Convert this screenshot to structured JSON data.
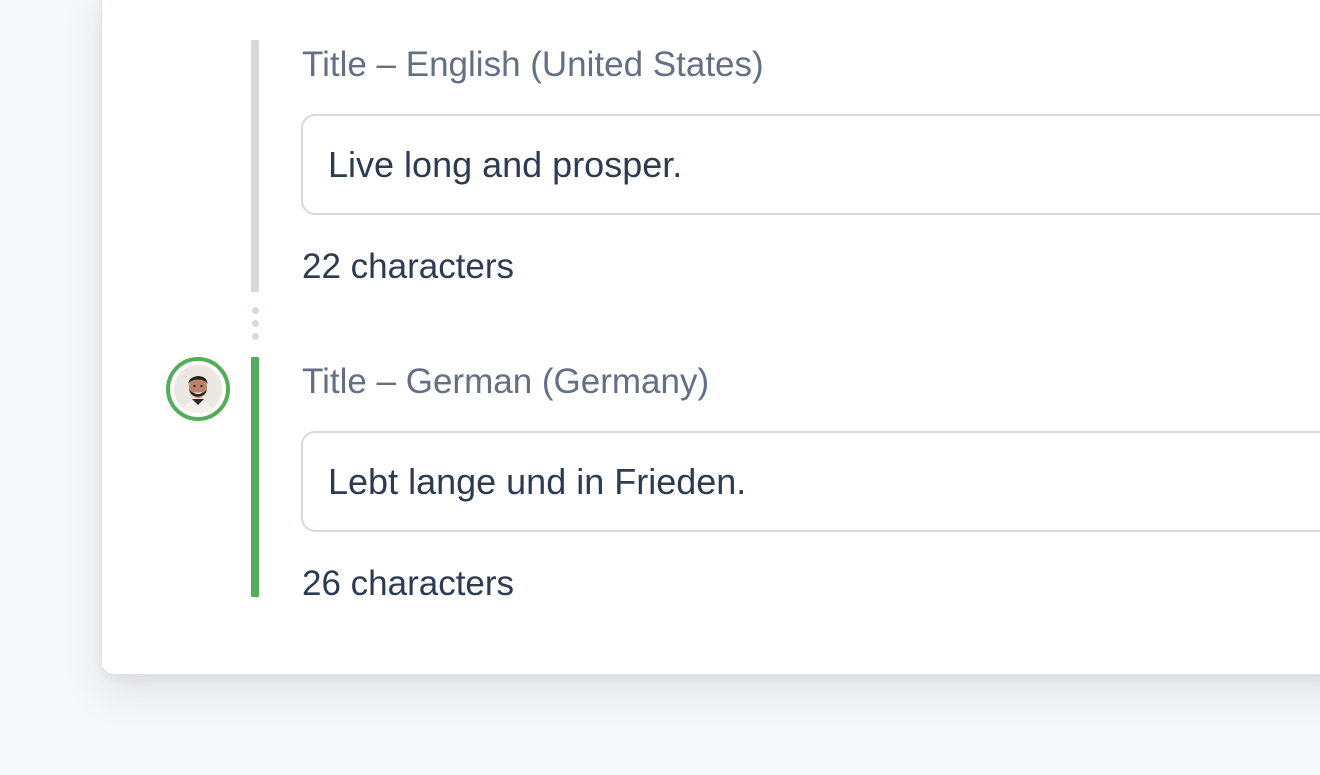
{
  "fields": [
    {
      "label": "Title – English (United States)",
      "value": "Live long and prosper.",
      "count": "22 characters",
      "rail_color": "#d3d9dd"
    },
    {
      "label": "Title – German (Germany)",
      "value": "Lebt lange und in Frieden.",
      "count": "26 characters",
      "rail_color": "#56ad58"
    }
  ],
  "avatar": {
    "icon": "user-avatar-photo",
    "ring_color": "#56ad58"
  }
}
